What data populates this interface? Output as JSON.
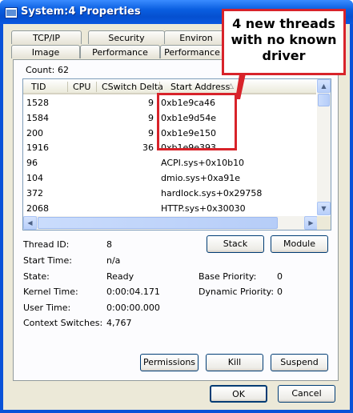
{
  "window": {
    "title": "System:4 Properties"
  },
  "tabs": {
    "row_back": [
      "TCP/IP",
      "Security",
      "Environ"
    ],
    "row_front": [
      "Image",
      "Performance",
      "Performance",
      "Threads"
    ]
  },
  "threads": {
    "count_label": "Count:",
    "count_value": "62",
    "columns": [
      "TID",
      "CPU",
      "CSwitch Delta",
      "Start Address"
    ],
    "sort_indicator": "△",
    "rows": [
      {
        "tid": "1528",
        "cpu": "",
        "cswitch": "9",
        "start": "0xb1e9ca46"
      },
      {
        "tid": "1584",
        "cpu": "",
        "cswitch": "9",
        "start": "0xb1e9d54e"
      },
      {
        "tid": "200",
        "cpu": "",
        "cswitch": "9",
        "start": "0xb1e9e150"
      },
      {
        "tid": "1916",
        "cpu": "",
        "cswitch": "36",
        "start": "0xb1e9e393"
      },
      {
        "tid": "96",
        "cpu": "",
        "cswitch": "",
        "start": "ACPI.sys+0x10b10"
      },
      {
        "tid": "104",
        "cpu": "",
        "cswitch": "",
        "start": "dmio.sys+0xa91e"
      },
      {
        "tid": "372",
        "cpu": "",
        "cswitch": "",
        "start": "hardlock.sys+0x29758"
      },
      {
        "tid": "2068",
        "cpu": "",
        "cswitch": "",
        "start": "HTTP.sys+0x30030"
      },
      {
        "tid": "2052",
        "cpu": "",
        "cswitch": "",
        "start": "HTTP.sys+0x329f0"
      }
    ]
  },
  "details": {
    "thread_id_label": "Thread ID:",
    "thread_id_value": "8",
    "start_time_label": "Start Time:",
    "start_time_value": "n/a",
    "state_label": "State:",
    "state_value": "Ready",
    "base_priority_label": "Base Priority:",
    "base_priority_value": "0",
    "kernel_time_label": "Kernel Time:",
    "kernel_time_value": "0:00:04.171",
    "dynamic_priority_label": "Dynamic Priority:",
    "dynamic_priority_value": "0",
    "user_time_label": "User Time:",
    "user_time_value": "0:00:00.000",
    "context_switches_label": "Context Switches:",
    "context_switches_value": "4,767"
  },
  "buttons": {
    "stack": "Stack",
    "module": "Module",
    "permissions": "Permissions",
    "kill": "Kill",
    "suspend": "Suspend",
    "ok": "OK",
    "cancel": "Cancel"
  },
  "annotation": {
    "text": "4 new threads with no known driver",
    "color": "#d8232a"
  }
}
